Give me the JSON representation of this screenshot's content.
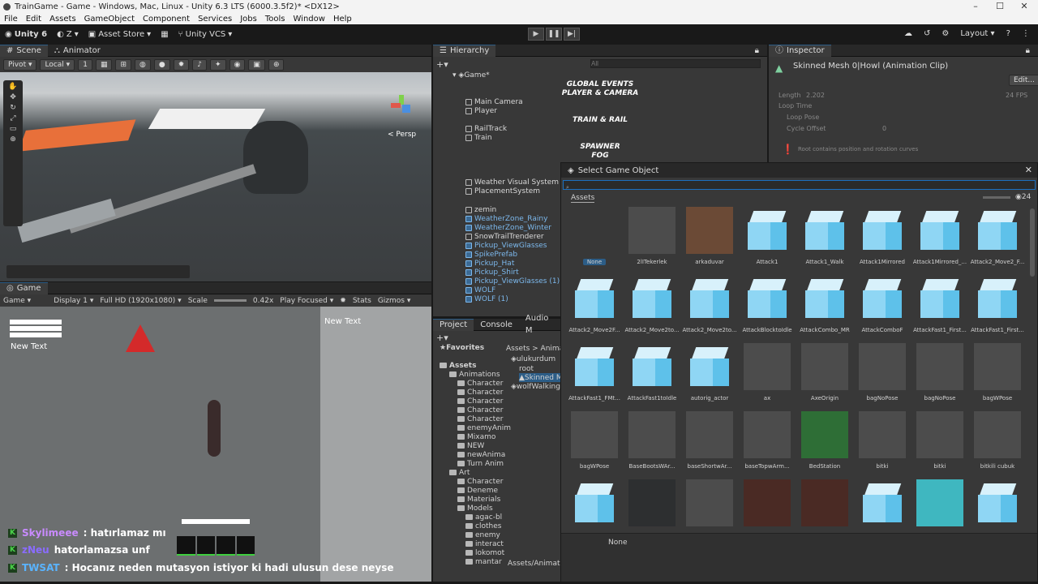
{
  "window": {
    "title": "TrainGame - Game - Windows, Mac, Linux - Unity 6.3 LTS (6000.3.5f2)* <DX12>"
  },
  "menu": [
    "File",
    "Edit",
    "Assets",
    "GameObject",
    "Component",
    "Services",
    "Jobs",
    "Tools",
    "Window",
    "Help"
  ],
  "toolbar": {
    "account": "Unity 6",
    "user": "Z",
    "asset_store": "Asset Store",
    "vcs": "Unity VCS",
    "layout": "Layout"
  },
  "scene": {
    "tabs": [
      "Scene",
      "Animator"
    ],
    "pivot": "Pivot",
    "local": "Local",
    "snap_value": "1",
    "persp": "< Persp"
  },
  "game": {
    "tab": "Game",
    "mode": "Game",
    "display": "Display 1",
    "resolution": "Full HD (1920x1080)",
    "scale_label": "Scale",
    "scale_value": "0.42x",
    "play_focus": "Play Focused",
    "stats": "Stats",
    "gizmos": "Gizmos",
    "new_text_left": "New Text",
    "new_text_right": "New Text"
  },
  "hierarchy": {
    "tab": "Hierarchy",
    "search_placeholder": "All",
    "root": "Game*",
    "rows": [
      {
        "text": "GLOBAL EVENTS",
        "type": "header"
      },
      {
        "text": "PLAYER & CAMERA",
        "type": "header"
      },
      {
        "text": "Main Camera",
        "type": "item"
      },
      {
        "text": "Player",
        "type": "item"
      },
      {
        "text": "TRAIN & RAIL",
        "type": "header"
      },
      {
        "text": "RailTrack",
        "type": "item"
      },
      {
        "text": "Train",
        "type": "item"
      },
      {
        "text": "SPAWNER",
        "type": "header"
      },
      {
        "text": "FOG",
        "type": "header"
      },
      {
        "text": "Weather Visual System",
        "type": "item"
      },
      {
        "text": "PlacementSystem",
        "type": "item"
      },
      {
        "text": "zemin",
        "type": "item"
      },
      {
        "text": "WeatherZone_Rainy",
        "type": "blue"
      },
      {
        "text": "WeatherZone_Winter",
        "type": "blue"
      },
      {
        "text": "SnowTrailTrenderer",
        "type": "item"
      },
      {
        "text": "Pickup_ViewGlasses",
        "type": "blue"
      },
      {
        "text": "SpikePrefab",
        "type": "blue"
      },
      {
        "text": "Pickup_Hat",
        "type": "blue"
      },
      {
        "text": "Pickup_Shirt",
        "type": "blue"
      },
      {
        "text": "Pickup_ViewGlasses (1)",
        "type": "blue"
      },
      {
        "text": "WOLF",
        "type": "blue"
      },
      {
        "text": "WOLF (1)",
        "type": "blue"
      }
    ]
  },
  "inspector": {
    "tab": "Inspector",
    "title": "Skinned Mesh 0|Howl (Animation Clip)",
    "edit": "Edit...",
    "length_label": "Length",
    "length_value": "2.202",
    "fps": "24 FPS",
    "loop_time": "Loop Time",
    "loop_pose": "Loop Pose",
    "cycle_offset": "Cycle Offset",
    "cycle_value": "0",
    "warning": "Root contains position and rotation curves"
  },
  "project": {
    "tabs": [
      "Project",
      "Console",
      "Audio M"
    ],
    "breadcrumb": "Assets > Animati",
    "favorites": "Favorites",
    "tree": [
      "Assets",
      "Animations",
      "Character",
      "Character",
      "Character",
      "Character",
      "Character",
      "enemyAnim",
      "Mixamo",
      "NEW",
      "newAnima",
      "Turn Anim",
      "Art",
      "Character",
      "Deneme",
      "Materials",
      "Models",
      "agac-bl",
      "clothes",
      "enemy",
      "interact",
      "lokomot",
      "mantar"
    ],
    "files": [
      "ulukurdum",
      "root",
      "Skinned M",
      "wolfWalking"
    ],
    "footer": "Assets/Animat"
  },
  "dialog": {
    "title": "Select Game Object",
    "tab": "Assets",
    "count": "24",
    "footer": "None",
    "items": [
      {
        "label": "None",
        "kind": "none"
      },
      {
        "label": "2lITekerlek",
        "kind": "gray"
      },
      {
        "label": "arkaduvar",
        "kind": "brown"
      },
      {
        "label": "Attack1",
        "kind": "cube"
      },
      {
        "label": "Attack1_Walk",
        "kind": "cube"
      },
      {
        "label": "Attack1Mirrored",
        "kind": "cube"
      },
      {
        "label": "Attack1Mirrored_...",
        "kind": "cube"
      },
      {
        "label": "Attack2_Move2_F...",
        "kind": "cube"
      },
      {
        "label": "Attack2_Move2F...",
        "kind": "cube"
      },
      {
        "label": "Attack2_Move2to...",
        "kind": "cube"
      },
      {
        "label": "Attack2_Move2to...",
        "kind": "cube"
      },
      {
        "label": "AttackBlocktoIdle",
        "kind": "cube"
      },
      {
        "label": "AttackCombo_MR",
        "kind": "cube"
      },
      {
        "label": "AttackComboF",
        "kind": "cube"
      },
      {
        "label": "AttackFast1_First...",
        "kind": "cube"
      },
      {
        "label": "AttackFast1_First...",
        "kind": "cube"
      },
      {
        "label": "AttackFast1_FMt...",
        "kind": "cube"
      },
      {
        "label": "AttackFast1toIdle",
        "kind": "cube"
      },
      {
        "label": "autorig_actor",
        "kind": "cube"
      },
      {
        "label": "ax",
        "kind": "gray"
      },
      {
        "label": "AxeOrigin",
        "kind": "gray"
      },
      {
        "label": "bagNoPose",
        "kind": "gray"
      },
      {
        "label": "bagNoPose",
        "kind": "gray"
      },
      {
        "label": "bagWPose",
        "kind": "gray"
      },
      {
        "label": "bagWPose",
        "kind": "gray"
      },
      {
        "label": "BaseBootsWAr...",
        "kind": "gray"
      },
      {
        "label": "baseShortwAr...",
        "kind": "gray"
      },
      {
        "label": "baseTopwArm...",
        "kind": "gray"
      },
      {
        "label": "BedStation",
        "kind": "green"
      },
      {
        "label": "bitki",
        "kind": "gray"
      },
      {
        "label": "bitki",
        "kind": "gray"
      },
      {
        "label": "bitkili cubuk",
        "kind": "gray"
      },
      {
        "label": "",
        "kind": "cube"
      },
      {
        "label": "",
        "kind": "dark"
      },
      {
        "label": "",
        "kind": "gray"
      },
      {
        "label": "",
        "kind": "boot"
      },
      {
        "label": "",
        "kind": "boot"
      },
      {
        "label": "",
        "kind": "cube"
      },
      {
        "label": "",
        "kind": "teal"
      },
      {
        "label": "",
        "kind": "cube"
      }
    ]
  },
  "chat": [
    {
      "user": "Skylimeee",
      "text": ": hatırlamaz mı",
      "color": "#c98bff"
    },
    {
      "user": "zNeu",
      "text": "hatorlamazsa unf",
      "color": "#8a6cff"
    },
    {
      "user": "TWSAT",
      "text": ": Hocanız neden mutasyon istiyor ki hadi ulusun dese neyse",
      "color": "#5ab4ff"
    }
  ]
}
